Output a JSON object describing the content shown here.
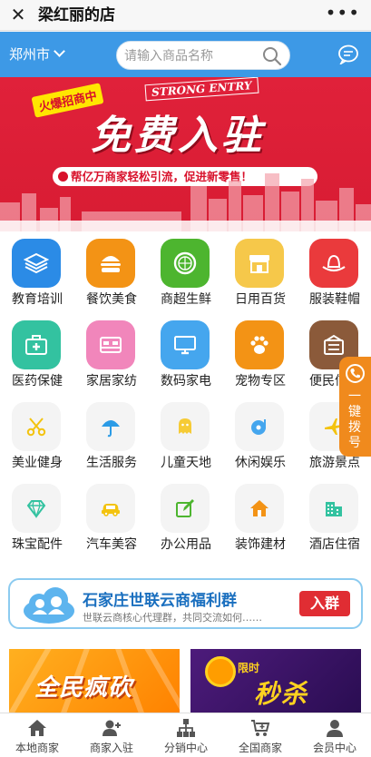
{
  "titlebar": {
    "close_glyph": "✕",
    "title": "梁红丽的店",
    "more_glyph": "•••"
  },
  "header": {
    "city": "郑州市",
    "search_placeholder": "请输入商品名称"
  },
  "banner": {
    "hot_tag": "火爆招商中",
    "english_tag": "STRONG ENTRY",
    "headline": "免费入驻",
    "slogan": "帮亿万商家轻松引流，促进新零售！",
    "accent_color": "#d81c33"
  },
  "categories": [
    {
      "label": "教育培训",
      "icon": "layers-icon",
      "color": "#2b8be6"
    },
    {
      "label": "餐饮美食",
      "icon": "burger-icon",
      "color": "#f39315"
    },
    {
      "label": "商超生鲜",
      "icon": "lime-icon",
      "color": "#4db52f"
    },
    {
      "label": "日用百货",
      "icon": "store-icon",
      "color": "#f6c84a"
    },
    {
      "label": "服装鞋帽",
      "icon": "hat-icon",
      "color": "#ea3a3c"
    },
    {
      "label": "医药保健",
      "icon": "medkit-icon",
      "color": "#33c2a0"
    },
    {
      "label": "家居家纺",
      "icon": "bed-icon",
      "color": "#f186bb"
    },
    {
      "label": "数码家电",
      "icon": "monitor-icon",
      "color": "#45a6ee"
    },
    {
      "label": "宠物专区",
      "icon": "paw-icon",
      "color": "#f39315"
    },
    {
      "label": "便民信息",
      "icon": "ticket-icon",
      "color": "#8b5a3a"
    },
    {
      "label": "美业健身",
      "icon": "scissors-icon",
      "color": "#f3c30f"
    },
    {
      "label": "生活服务",
      "icon": "umbrella-icon",
      "color": "#2b9be6"
    },
    {
      "label": "儿童天地",
      "icon": "ghost-icon",
      "color": "#f6cb35"
    },
    {
      "label": "休闲娱乐",
      "icon": "music-disc-icon",
      "color": "#45a6ee"
    },
    {
      "label": "旅游景点",
      "icon": "airplane-icon",
      "color": "#f3c30f"
    },
    {
      "label": "珠宝配件",
      "icon": "diamond-icon",
      "color": "#33c2a0"
    },
    {
      "label": "汽车美容",
      "icon": "car-icon",
      "color": "#f3c30f"
    },
    {
      "label": "办公用品",
      "icon": "pen-icon",
      "color": "#4db52f"
    },
    {
      "label": "装饰建材",
      "icon": "house-icon",
      "color": "#f39315"
    },
    {
      "label": "酒店住宿",
      "icon": "building-icon",
      "color": "#33c2a0"
    }
  ],
  "side_tab": {
    "label": "一键拨号"
  },
  "group_card": {
    "title": "石家庄世联云商福利群",
    "subtitle": "世联云商核心代理群，共同交流如何……",
    "join_label": "入群"
  },
  "promos": {
    "left_text": "全民疯砍",
    "right_small": "限时",
    "right_text": "秒杀"
  },
  "tabbar": [
    {
      "label": "本地商家",
      "icon": "home-icon"
    },
    {
      "label": "商家入驻",
      "icon": "add-user-icon"
    },
    {
      "label": "分销中心",
      "icon": "network-icon"
    },
    {
      "label": "全国商家",
      "icon": "cart-icon"
    },
    {
      "label": "会员中心",
      "icon": "member-icon"
    }
  ]
}
